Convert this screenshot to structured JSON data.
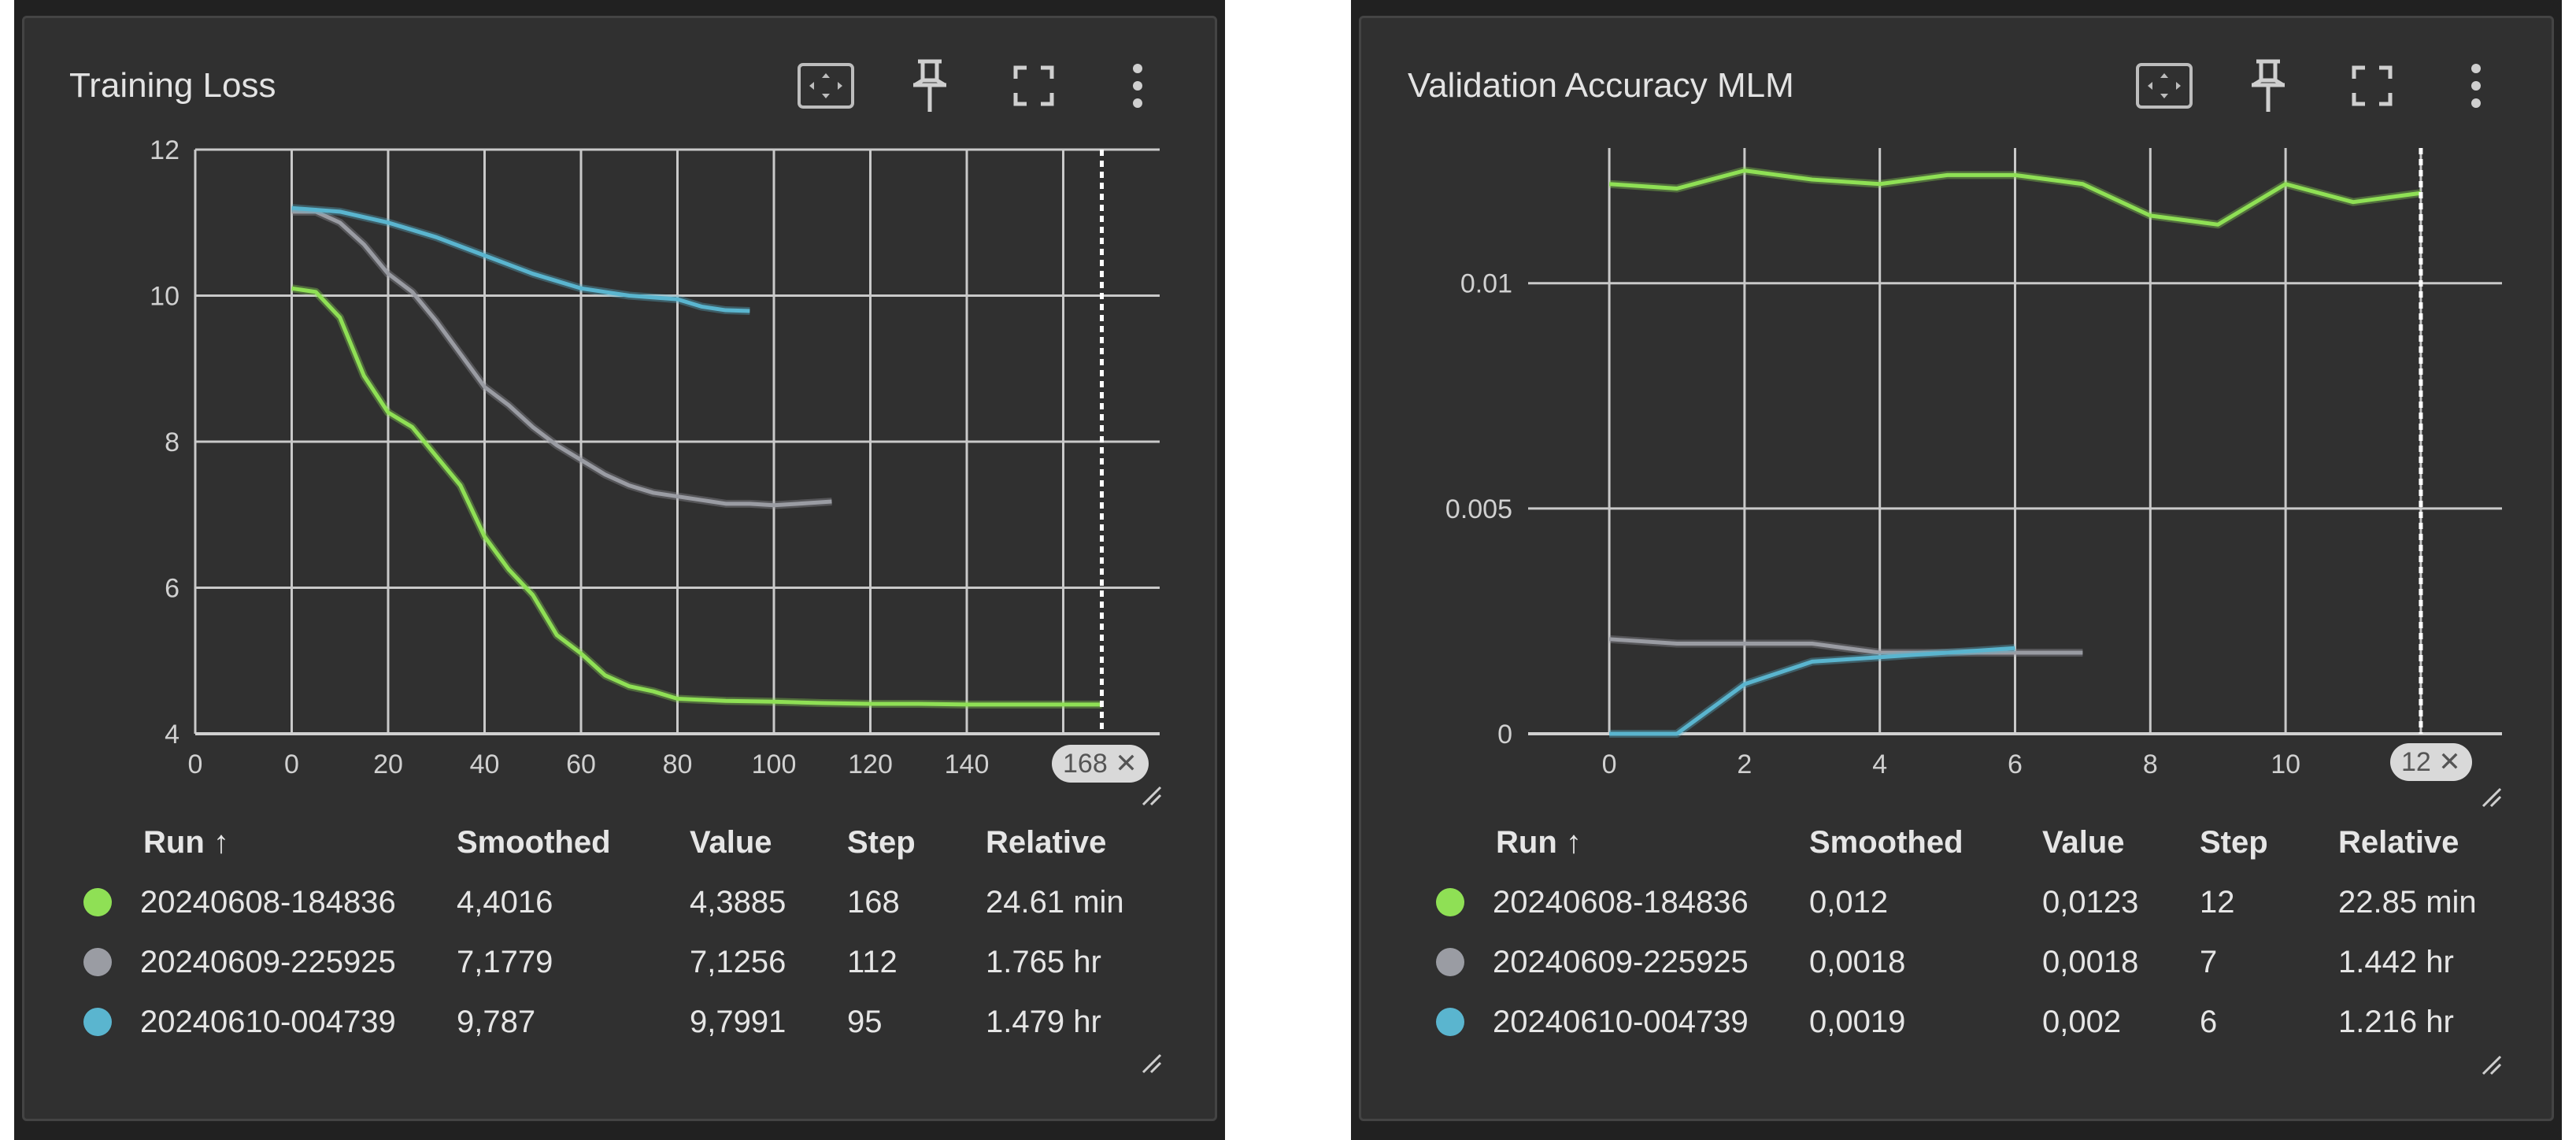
{
  "panels": [
    {
      "title": "Training Loss",
      "toolbar_icons": [
        "fit-domain-icon",
        "pin-icon",
        "fullscreen-icon",
        "more-vert-icon"
      ],
      "cursor_step": "168",
      "legend": {
        "headers": {
          "run": "Run ↑",
          "smoothed": "Smoothed",
          "value": "Value",
          "step": "Step",
          "relative": "Relative"
        },
        "rows": [
          {
            "color": "#8fe055",
            "run": "20240608-184836",
            "smoothed": "4,4016",
            "value": "4,3885",
            "step": "168",
            "relative": "24.61 min"
          },
          {
            "color": "#9a9ca3",
            "run": "20240609-225925",
            "smoothed": "7,1779",
            "value": "7,1256",
            "step": "112",
            "relative": "1.765 hr"
          },
          {
            "color": "#5ab5cf",
            "run": "20240610-004739",
            "smoothed": "9,787",
            "value": "9,7991",
            "step": "95",
            "relative": "1.479 hr"
          }
        ]
      }
    },
    {
      "title": "Validation Accuracy MLM",
      "toolbar_icons": [
        "fit-domain-icon",
        "pin-icon",
        "fullscreen-icon",
        "more-vert-icon"
      ],
      "cursor_step": "12",
      "legend": {
        "headers": {
          "run": "Run ↑",
          "smoothed": "Smoothed",
          "value": "Value",
          "step": "Step",
          "relative": "Relative"
        },
        "rows": [
          {
            "color": "#8fe055",
            "run": "20240608-184836",
            "smoothed": "0,012",
            "value": "0,0123",
            "step": "12",
            "relative": "22.85 min"
          },
          {
            "color": "#9a9ca3",
            "run": "20240609-225925",
            "smoothed": "0,0018",
            "value": "0,0018",
            "step": "7",
            "relative": "1.442 hr"
          },
          {
            "color": "#5ab5cf",
            "run": "20240610-004739",
            "smoothed": "0,0019",
            "value": "0,002",
            "step": "6",
            "relative": "1.216 hr"
          }
        ]
      }
    }
  ],
  "chart_data": [
    {
      "type": "line",
      "title": "Training Loss",
      "xlim": [
        -20,
        180
      ],
      "ylim": [
        4,
        12
      ],
      "x_ticks": [
        "0",
        "0",
        "20",
        "40",
        "60",
        "80",
        "100",
        "120",
        "140",
        "1"
      ],
      "x_tick_values": [
        -20,
        0,
        20,
        40,
        60,
        80,
        100,
        120,
        140,
        160
      ],
      "y_ticks": [
        "4",
        "6",
        "8",
        "10",
        "12"
      ],
      "y_tick_values": [
        4,
        6,
        8,
        10,
        12
      ],
      "cursor_x": 168,
      "series": [
        {
          "name": "20240608-184836",
          "color": "#8fe055",
          "x": [
            0,
            5,
            10,
            15,
            20,
            25,
            30,
            35,
            40,
            45,
            50,
            55,
            60,
            65,
            70,
            75,
            80,
            90,
            100,
            110,
            120,
            130,
            140,
            150,
            160,
            168
          ],
          "y": [
            10.1,
            10.05,
            9.7,
            8.9,
            8.4,
            8.2,
            7.8,
            7.4,
            6.7,
            6.25,
            5.9,
            5.35,
            5.1,
            4.8,
            4.65,
            4.58,
            4.48,
            4.45,
            4.44,
            4.42,
            4.41,
            4.41,
            4.4,
            4.4,
            4.4,
            4.4
          ]
        },
        {
          "name": "20240609-225925",
          "color": "#9a9ca3",
          "x": [
            0,
            5,
            10,
            15,
            20,
            25,
            30,
            35,
            40,
            45,
            50,
            55,
            60,
            65,
            70,
            75,
            80,
            85,
            90,
            95,
            100,
            105,
            112
          ],
          "y": [
            11.15,
            11.15,
            11.0,
            10.7,
            10.3,
            10.05,
            9.65,
            9.2,
            8.75,
            8.5,
            8.2,
            7.95,
            7.75,
            7.55,
            7.4,
            7.3,
            7.25,
            7.2,
            7.15,
            7.15,
            7.13,
            7.15,
            7.18
          ]
        },
        {
          "name": "20240610-004739",
          "color": "#5ab5cf",
          "x": [
            0,
            10,
            20,
            30,
            40,
            50,
            60,
            70,
            80,
            85,
            90,
            95
          ],
          "y": [
            11.2,
            11.15,
            11.0,
            10.8,
            10.55,
            10.3,
            10.1,
            10.0,
            9.95,
            9.85,
            9.8,
            9.79
          ]
        }
      ]
    },
    {
      "type": "line",
      "title": "Validation Accuracy MLM",
      "xlim": [
        -1.2,
        13.2
      ],
      "ylim": [
        0,
        0.013
      ],
      "x_ticks": [
        "0",
        "2",
        "4",
        "6",
        "8",
        "10",
        "12"
      ],
      "x_tick_values": [
        0,
        2,
        4,
        6,
        8,
        10,
        12
      ],
      "y_ticks": [
        "0",
        "0.005",
        "0.01"
      ],
      "y_tick_values": [
        0,
        0.005,
        0.01
      ],
      "cursor_x": 12,
      "series": [
        {
          "name": "20240608-184836",
          "color": "#8fe055",
          "x": [
            0,
            1,
            2,
            3,
            4,
            5,
            6,
            7,
            8,
            9,
            10,
            11,
            12
          ],
          "y": [
            0.0122,
            0.0121,
            0.0125,
            0.0123,
            0.0122,
            0.0124,
            0.0124,
            0.0122,
            0.0115,
            0.0113,
            0.0122,
            0.0118,
            0.012
          ]
        },
        {
          "name": "20240609-225925",
          "color": "#9a9ca3",
          "x": [
            0,
            1,
            2,
            3,
            4,
            5,
            6,
            7
          ],
          "y": [
            0.0021,
            0.002,
            0.002,
            0.002,
            0.0018,
            0.0018,
            0.0018,
            0.0018
          ]
        },
        {
          "name": "20240610-004739",
          "color": "#5ab5cf",
          "x": [
            0,
            1,
            2,
            3,
            4,
            5,
            6
          ],
          "y": [
            0.0,
            0.0,
            0.0011,
            0.0016,
            0.0017,
            0.0018,
            0.0019
          ]
        }
      ]
    }
  ]
}
